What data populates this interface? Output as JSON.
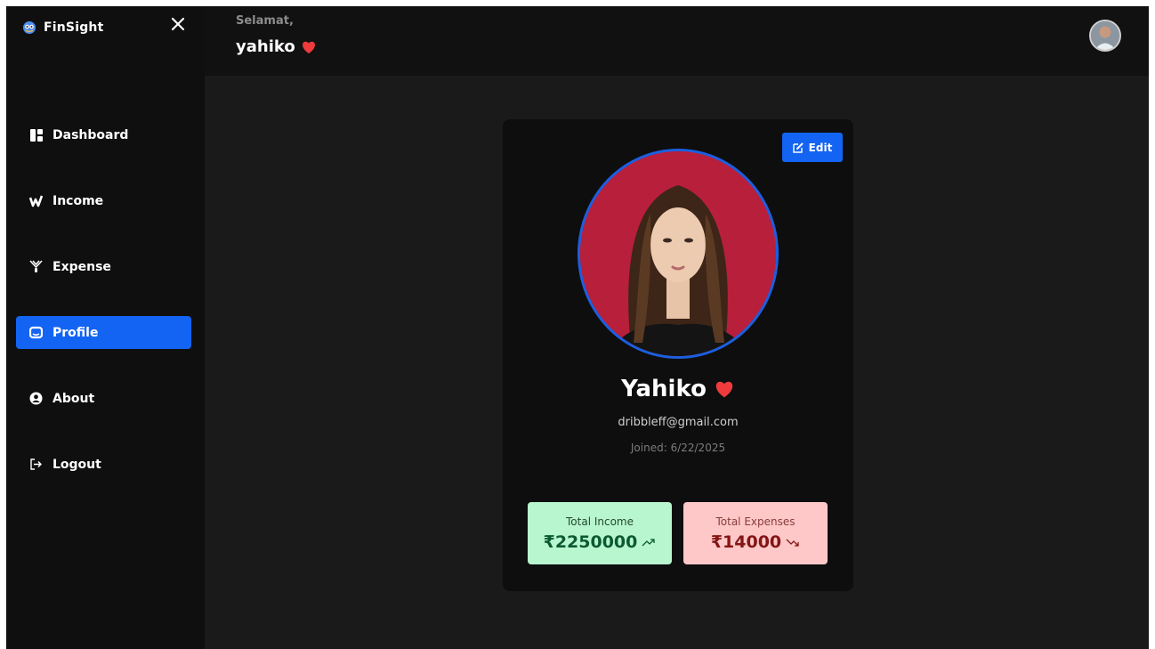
{
  "app": {
    "name": "FinSight"
  },
  "colors": {
    "accent": "#1464f4",
    "income_bg": "#b8f6cf",
    "expense_bg": "#fec8c8",
    "heart": "#ef3b3b"
  },
  "sidebar": {
    "items": [
      {
        "label": "Dashboard",
        "icon": "dashboard-icon"
      },
      {
        "label": "Income",
        "icon": "income-icon"
      },
      {
        "label": "Expense",
        "icon": "expense-icon"
      },
      {
        "label": "Profile",
        "icon": "profile-icon",
        "active": true
      },
      {
        "label": "About",
        "icon": "user-circle-icon"
      },
      {
        "label": "Logout",
        "icon": "logout-icon"
      }
    ]
  },
  "header": {
    "greeting": "Selamat,",
    "username": "yahiko"
  },
  "profile": {
    "edit_label": "Edit",
    "name": "Yahiko",
    "email": "dribbleff@gmail.com",
    "joined": "Joined: 6/22/2025",
    "income": {
      "label": "Total Income",
      "value": "₹2250000"
    },
    "expense": {
      "label": "Total Expenses",
      "value": "₹14000"
    }
  }
}
